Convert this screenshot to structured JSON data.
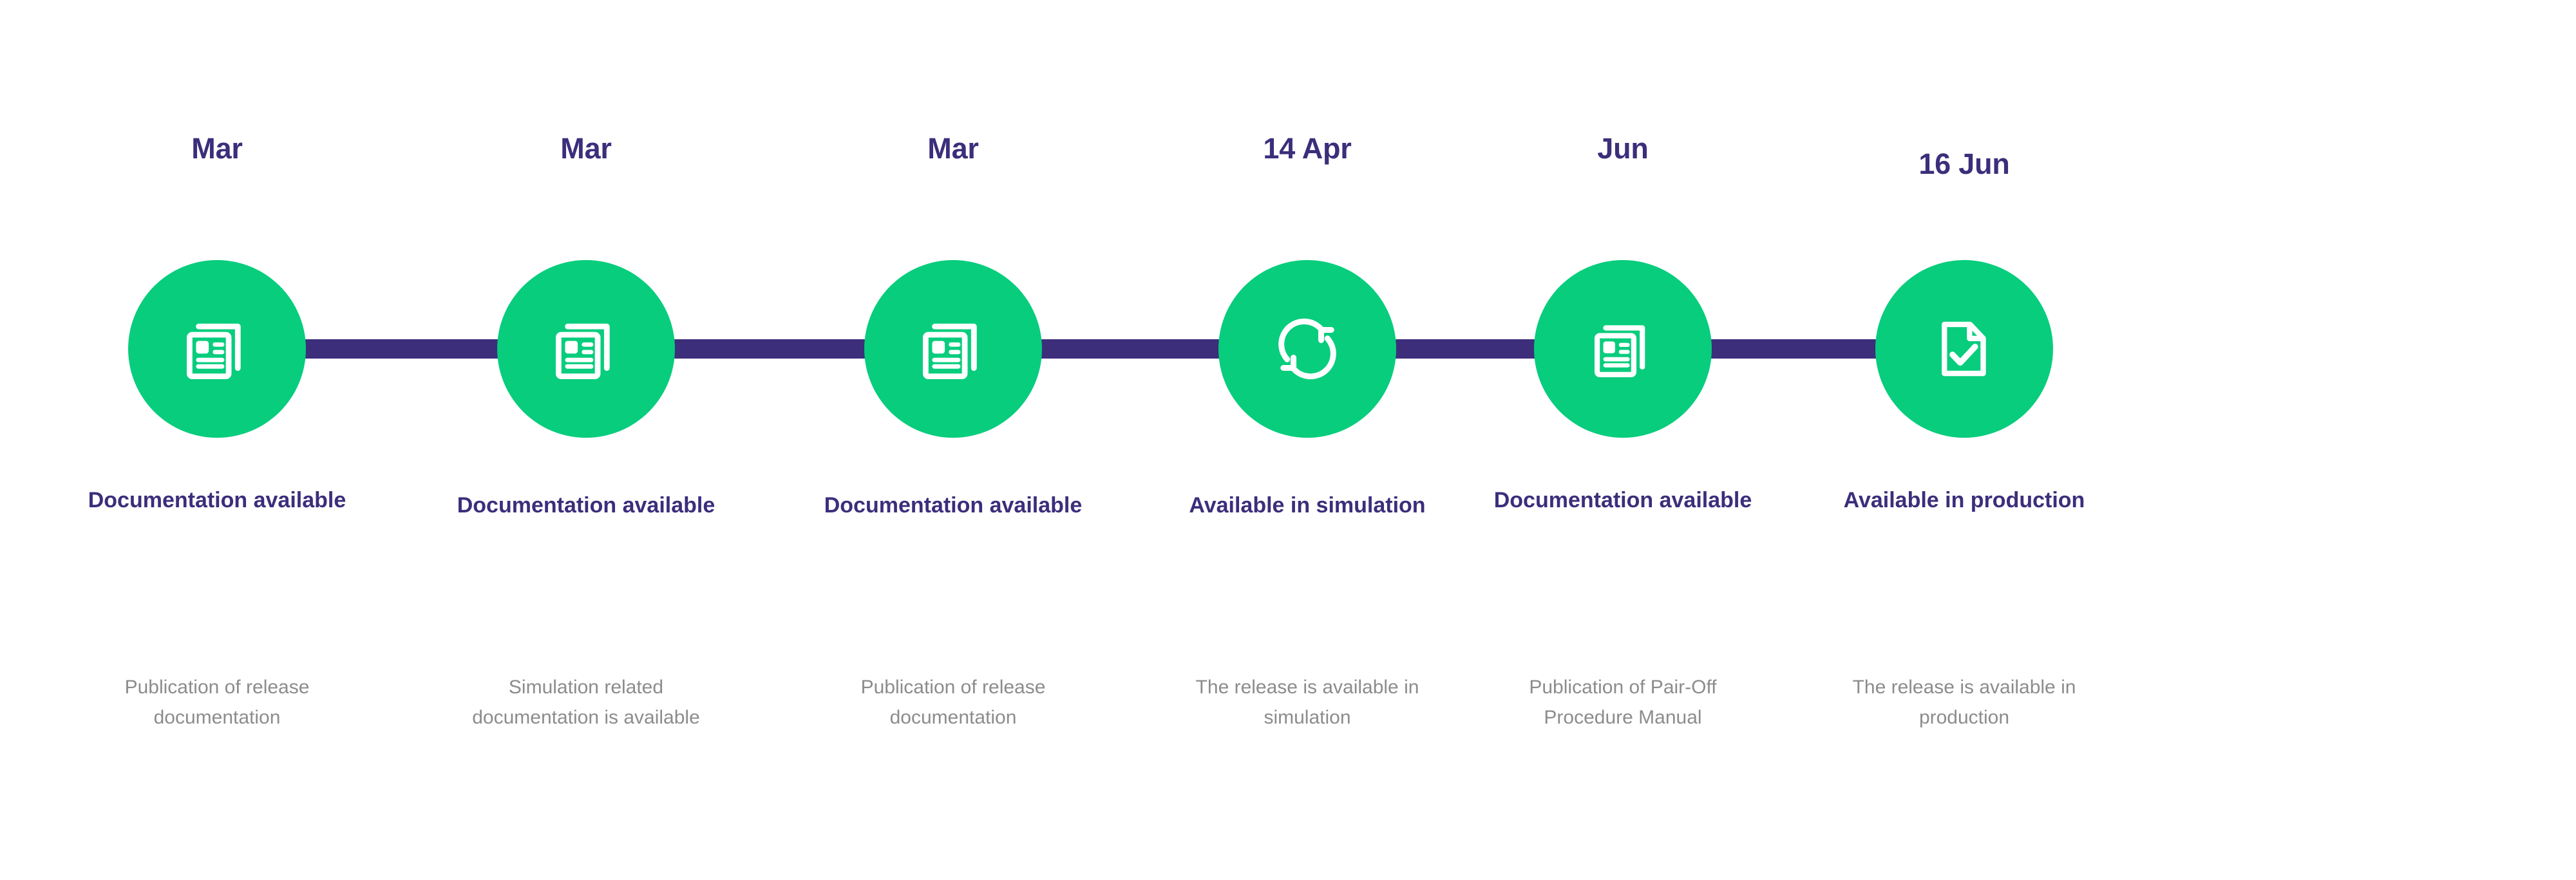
{
  "diagram": {
    "type": "timeline",
    "title": "Release milestone timeline",
    "colors": {
      "accent_green": "#07cd7d",
      "accent_purple": "#3c2e7b",
      "description_gray": "#8c8c8c",
      "background": "#ffffff"
    },
    "milestones": [
      {
        "date": "Mar",
        "icon": "documents-icon",
        "label": "Documentation available",
        "description": "Publication of release documentation"
      },
      {
        "date": "Mar",
        "icon": "documents-icon",
        "label": "Documentation available",
        "description": "Simulation related documentation is available"
      },
      {
        "date": "Mar",
        "icon": "documents-icon",
        "label": "Documentation available",
        "description": "Publication of release documentation"
      },
      {
        "date": "14 Apr",
        "icon": "sync-arrows-icon",
        "label": "Available in simulation",
        "description": "The release is available in simulation"
      },
      {
        "date": "Jun",
        "icon": "documents-icon",
        "label": "Documentation available",
        "description": "Publication of Pair-Off Procedure Manual"
      },
      {
        "date": "16 Jun",
        "icon": "document-check-icon",
        "label": "Available in production",
        "description": "The release is available in production"
      }
    ]
  }
}
